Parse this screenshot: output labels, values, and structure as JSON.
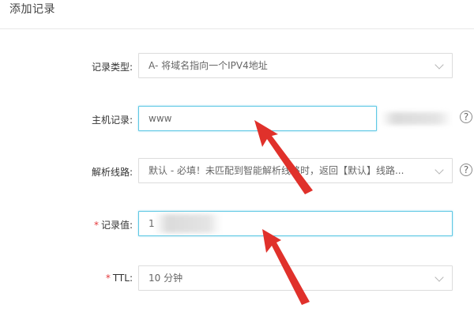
{
  "header": {
    "title": "添加记录"
  },
  "form": {
    "record_type": {
      "label": "记录类型:",
      "value": "A- 将域名指向一个IPV4地址"
    },
    "host_record": {
      "label": "主机记录:",
      "value": "www"
    },
    "resolve_line": {
      "label": "解析线路:",
      "value": "默认 - 必填！未匹配到智能解析线路时，返回【默认】线路..."
    },
    "record_value": {
      "required_mark": "*",
      "label": "记录值:",
      "value": "1"
    },
    "ttl": {
      "required_mark": "*",
      "label": "TTL:",
      "value": "10 分钟"
    }
  },
  "icons": {
    "help": "?",
    "chevron": "chevron-down-icon"
  },
  "colors": {
    "focus_border": "#5ec8e4",
    "required": "#e4393c",
    "annotation_arrow": "#e0312b"
  }
}
